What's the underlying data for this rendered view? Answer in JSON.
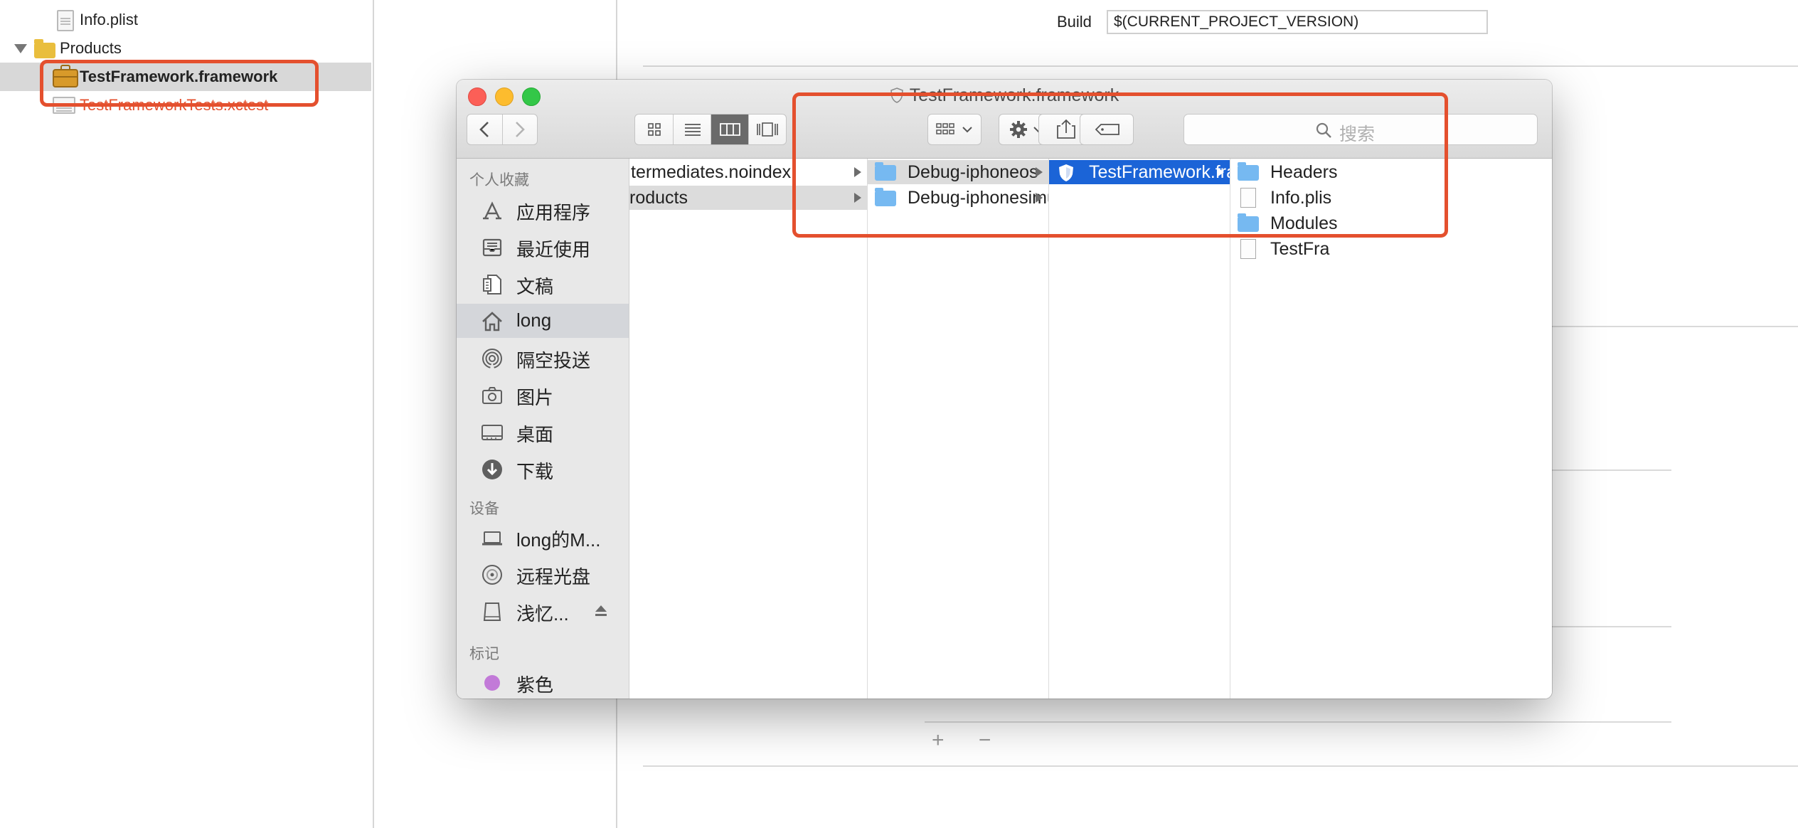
{
  "navigator": {
    "items": [
      {
        "label": "Info.plist"
      },
      {
        "label": "Products"
      },
      {
        "label": "TestFramework.framework"
      },
      {
        "label": "TestFrameworkTests.xctest"
      }
    ]
  },
  "build_settings": {
    "build_label": "Build",
    "build_value": "$(CURRENT_PROJECT_VERSION)",
    "add_remove": "+ −"
  },
  "finder": {
    "title": "TestFramework.framework",
    "search_placeholder": "搜索",
    "sidebar": {
      "favorites_heading": "个人收藏",
      "favorites": [
        {
          "label": "应用程序",
          "icon": "applications-icon"
        },
        {
          "label": "最近使用",
          "icon": "recents-icon"
        },
        {
          "label": "文稿",
          "icon": "documents-icon"
        },
        {
          "label": "long",
          "icon": "home-icon"
        },
        {
          "label": "隔空投送",
          "icon": "airdrop-icon"
        },
        {
          "label": "图片",
          "icon": "camera-icon"
        },
        {
          "label": "桌面",
          "icon": "desktop-icon"
        },
        {
          "label": "下载",
          "icon": "download-icon"
        }
      ],
      "devices_heading": "设备",
      "devices": [
        {
          "label": "long的M...",
          "icon": "laptop-icon"
        },
        {
          "label": "远程光盘",
          "icon": "disc-icon"
        },
        {
          "label": "浅忆...",
          "icon": "drive-icon"
        }
      ],
      "tags_heading": "标记",
      "tags": [
        {
          "label": "紫色",
          "color": "#c27ad8"
        }
      ]
    },
    "columns": [
      {
        "items": [
          "termediates.noindex",
          "roducts"
        ]
      },
      {
        "items": [
          "Debug-iphoneos",
          "Debug-iphonesimulator"
        ]
      },
      {
        "items": [
          "TestFramework.framework"
        ]
      },
      {
        "items": [
          "Headers",
          "Info.plis",
          "Modules",
          "TestFra"
        ]
      }
    ]
  },
  "colors": {
    "annotation_red": "#e4502e",
    "selection_blue": "#1b64d7"
  }
}
